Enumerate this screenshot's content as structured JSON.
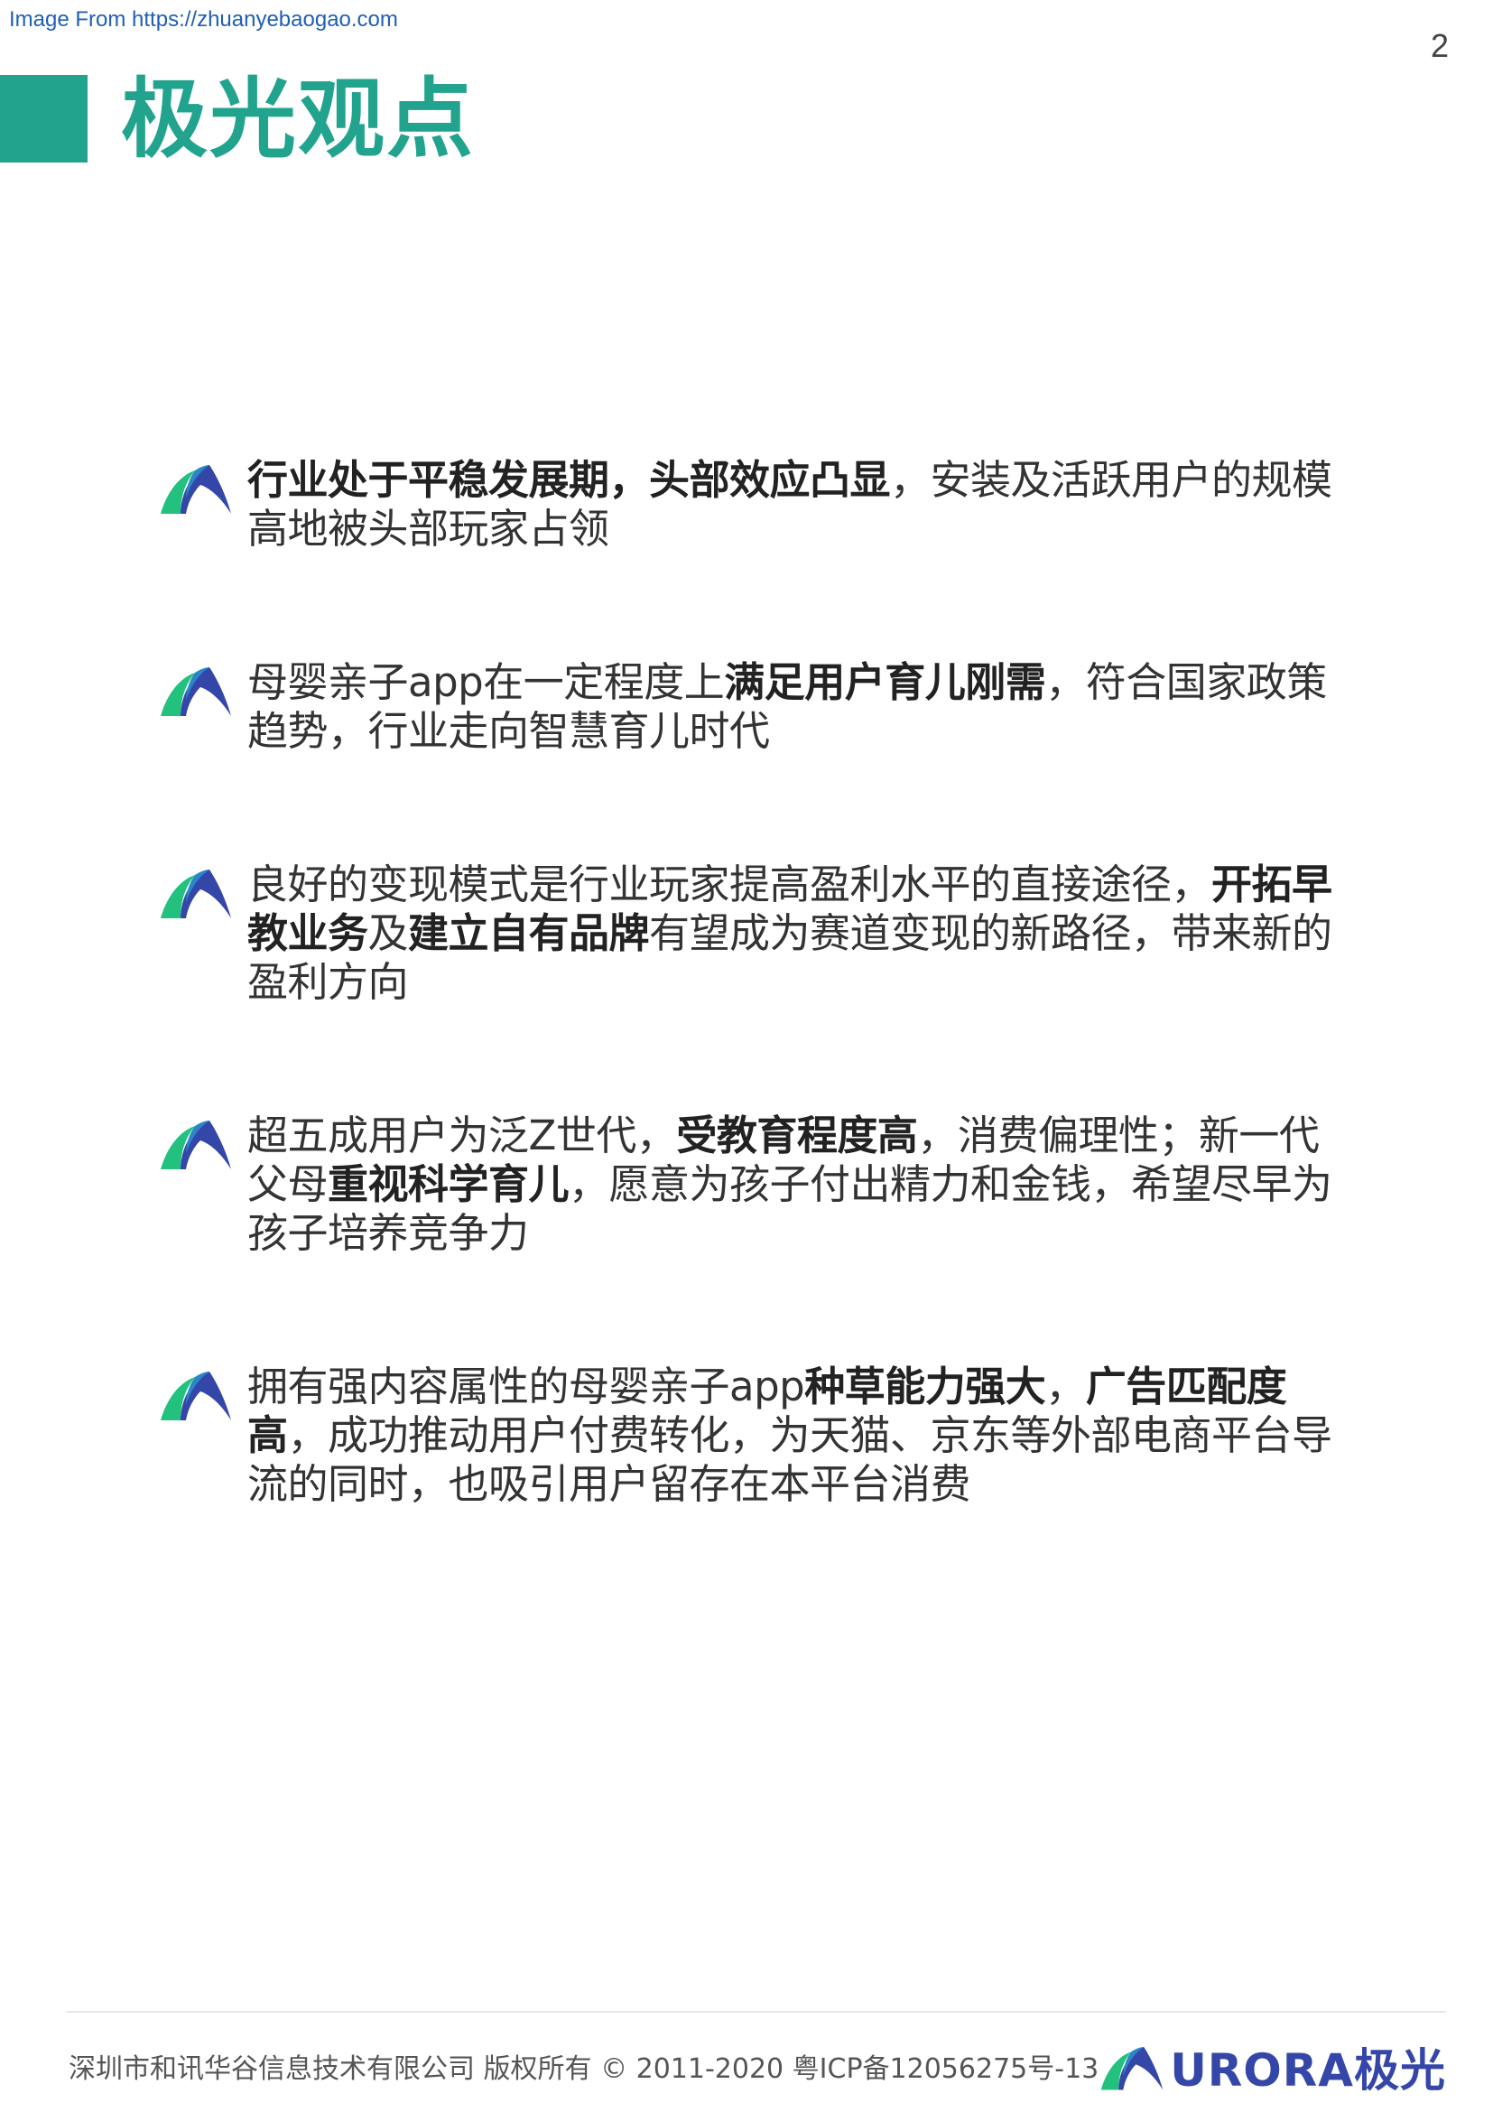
{
  "source_link": "Image From https://zhuanyebaogao.com",
  "page_number": "2",
  "title": "极光观点",
  "colors": {
    "accent": "#21a38e",
    "logo_blue": "#3447a8",
    "logo_green": "#22c27e",
    "body_text": "#333333"
  },
  "points": [
    {
      "icon": "aurora-logo-icon",
      "segments": [
        {
          "text": "行业处于平稳发展期，头部效应凸显",
          "bold": true
        },
        {
          "text": "，安装及活跃用户的规模高地被头部玩家占领",
          "bold": false
        }
      ]
    },
    {
      "icon": "aurora-logo-icon",
      "segments": [
        {
          "text": "母婴亲子app在一定程度上",
          "bold": false
        },
        {
          "text": "满足用户育儿刚需",
          "bold": true
        },
        {
          "text": "，符合国家政策趋势，行业走向智慧育儿时代",
          "bold": false
        }
      ]
    },
    {
      "icon": "aurora-logo-icon",
      "segments": [
        {
          "text": "良好的变现模式是行业玩家提高盈利水平的直接途径，",
          "bold": false
        },
        {
          "text": "开拓早教业务",
          "bold": true
        },
        {
          "text": "及",
          "bold": false
        },
        {
          "text": "建立自有品牌",
          "bold": true
        },
        {
          "text": "有望成为赛道变现的新路径，带来新的盈利方向",
          "bold": false
        }
      ]
    },
    {
      "icon": "aurora-logo-icon",
      "segments": [
        {
          "text": "超五成用户为泛Z世代，",
          "bold": false
        },
        {
          "text": "受教育程度高",
          "bold": true
        },
        {
          "text": "，消费偏理性；新一代父母",
          "bold": false
        },
        {
          "text": "重视科学育儿",
          "bold": true
        },
        {
          "text": "，愿意为孩子付出精力和金钱，希望尽早为孩子培养竞争力",
          "bold": false
        }
      ]
    },
    {
      "icon": "aurora-logo-icon",
      "segments": [
        {
          "text": "拥有强内容属性的母婴亲子app",
          "bold": false
        },
        {
          "text": "种草能力强大",
          "bold": true
        },
        {
          "text": "，",
          "bold": false
        },
        {
          "text": "广告匹配度高",
          "bold": true
        },
        {
          "text": "，成功推动用户付费转化，为天猫、京东等外部电商平台导流的同时，也吸引用户留存在本平台消费",
          "bold": false
        }
      ]
    }
  ],
  "footer": {
    "copyright": "深圳市和讯华谷信息技术有限公司 版权所有 © 2011-2020 粤ICP备12056275号-13",
    "logo_text": "URORA极光"
  }
}
